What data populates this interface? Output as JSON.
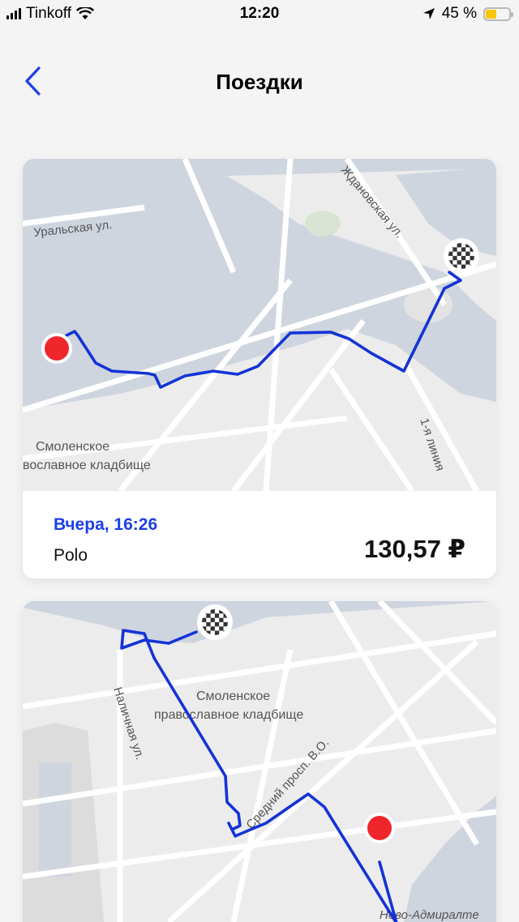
{
  "status_bar": {
    "carrier": "Tinkoff",
    "time": "12:20",
    "battery_percent": "45 %"
  },
  "header": {
    "title": "Поездки"
  },
  "trips": [
    {
      "date": "Вчера, 16:26",
      "car": "Polo",
      "price": "130,57 ₽",
      "map_labels": {
        "street1": "Уральская ул.",
        "street2": "Ждановская ул.",
        "cemetery_line1": "Смоленское",
        "cemetery_line2": "вославное кладбище",
        "line": "1-я линия"
      }
    },
    {
      "map_labels": {
        "cemetery_line1": "Смоленское",
        "cemetery_line2": "православное кладбище",
        "street1": "Наличная ул.",
        "street2": "Средний просп. В.О.",
        "district": "Ново-Адмиралте"
      }
    }
  ],
  "colors": {
    "accent": "#1c3fe6",
    "route": "#1433d6",
    "start_marker": "#f0262d",
    "water": "#cfd5df",
    "map_bg": "#ececec"
  }
}
